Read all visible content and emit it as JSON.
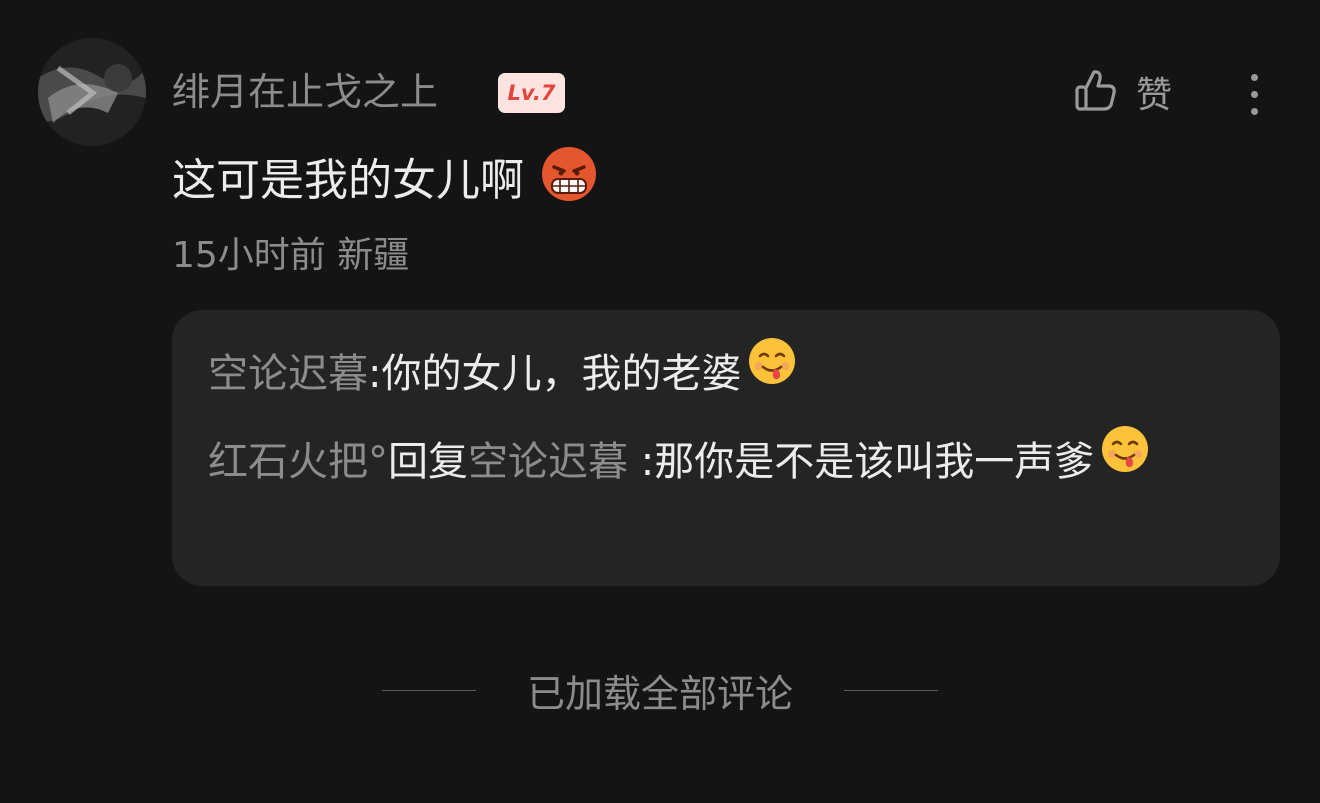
{
  "comment": {
    "username": "绯月在止戈之上",
    "level_badge": "Lv.7",
    "like_label": "赞",
    "text": "这可是我的女儿啊",
    "emoji": "angry-grimace-emoji",
    "meta": "15小时前 新疆"
  },
  "replies": [
    {
      "author": "空论迟暮",
      "separator": ":",
      "text": "你的女儿，我的老婆",
      "emoji": "yum-face-emoji"
    },
    {
      "author": "红石火把°",
      "reply_word": "回复",
      "target": "空论迟暮",
      "separator": " :",
      "text": "那你是不是该叫我一声爹",
      "emoji": "yum-face-emoji"
    }
  ],
  "footer": {
    "text": "已加载全部评论"
  },
  "colors": {
    "background": "#141414",
    "reply_box": "#242424",
    "dim_text": "#8c8c8c",
    "badge_bg": "#fde4e1",
    "badge_text": "#e2463c"
  }
}
